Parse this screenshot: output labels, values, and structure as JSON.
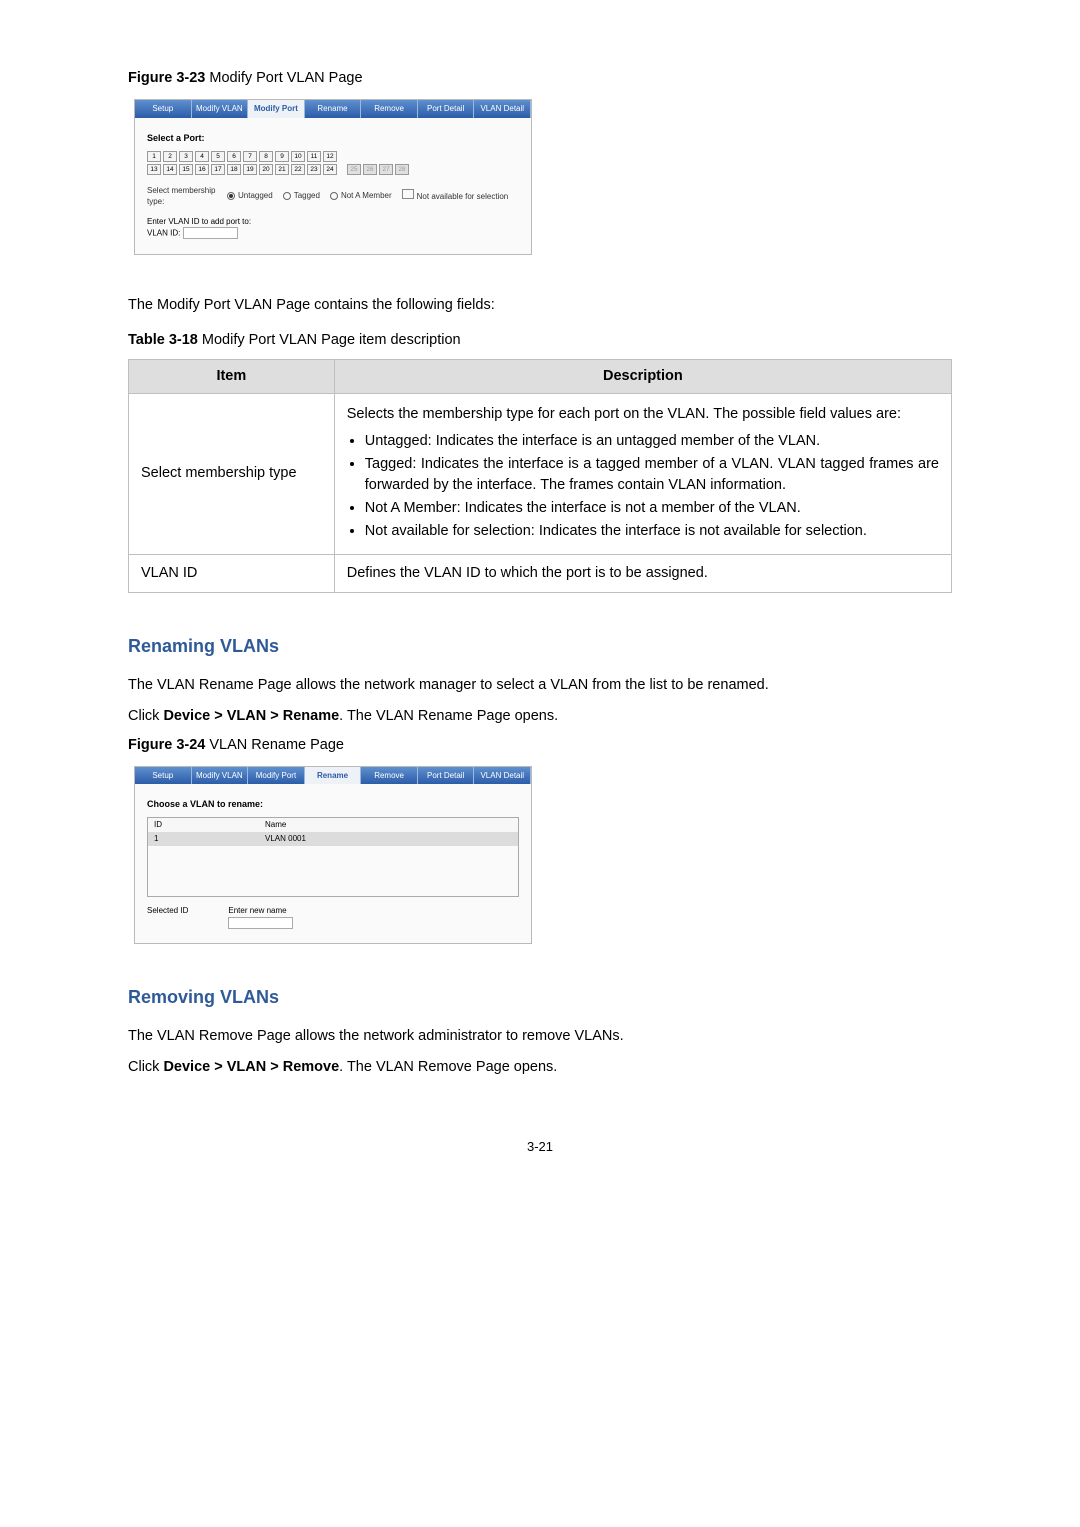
{
  "figure23": {
    "label": "Figure 3-23",
    "title": "Modify Port VLAN Page"
  },
  "screenshot1": {
    "tabs": [
      "Setup",
      "Modify VLAN",
      "Modify Port",
      "Rename",
      "Remove",
      "Port Detail",
      "VLAN Detail"
    ],
    "active_tab_index": 2,
    "select_port_label": "Select a Port:",
    "ports_top": [
      "1",
      "2",
      "3",
      "4",
      "5",
      "6",
      "7",
      "8",
      "9",
      "10",
      "11",
      "12"
    ],
    "ports_bottom_a": [
      "13",
      "14",
      "15",
      "16",
      "17",
      "18",
      "19",
      "20",
      "21",
      "22",
      "23",
      "24"
    ],
    "ports_bottom_b": [
      "25",
      "26",
      "27",
      "28"
    ],
    "mem_label": "Select membership type:",
    "mem_untagged": "Untagged",
    "mem_tagged": "Tagged",
    "mem_not_member": "Not A Member",
    "legend_label": "Not available for selection",
    "enter_vlan_label": "Enter VLAN ID to add port to:",
    "vlan_id_label": "VLAN ID:"
  },
  "intro1": "The Modify Port VLAN Page contains the following fields:",
  "table318": {
    "label": "Table 3-18",
    "title": "Modify Port VLAN Page item description",
    "head_item": "Item",
    "head_desc": "Description",
    "row1_item": "Select membership type",
    "row1_intro": "Selects the membership type for each port on the VLAN. The possible field values are:",
    "row1_b1": "Untagged: Indicates the interface is an untagged member of the VLAN.",
    "row1_b2": "Tagged: Indicates the interface is a tagged member of a VLAN. VLAN tagged frames are forwarded by the interface. The frames contain VLAN information.",
    "row1_b3": "Not A Member: Indicates the interface is not a member of the VLAN.",
    "row1_b4": "Not available for selection: Indicates the interface is not available for selection.",
    "row2_item": "VLAN ID",
    "row2_desc": "Defines the VLAN ID to which the port is to be assigned."
  },
  "renaming": {
    "heading": "Renaming VLANs",
    "para1": "The VLAN Rename Page allows the network manager to select a VLAN from the list to be renamed.",
    "click_prefix": "Click ",
    "breadcrumb": "Device > VLAN > Rename",
    "click_suffix": ". The VLAN Rename Page opens."
  },
  "figure24": {
    "label": "Figure 3-24",
    "title": "VLAN Rename Page"
  },
  "screenshot2": {
    "tabs": [
      "Setup",
      "Modify VLAN",
      "Modify Port",
      "Rename",
      "Remove",
      "Port Detail",
      "VLAN Detail"
    ],
    "active_tab_index": 3,
    "choose_label": "Choose a VLAN to rename:",
    "col_id": "ID",
    "col_name": "Name",
    "row_id": "1",
    "row_name": "VLAN 0001",
    "selected_id_label": "Selected ID",
    "enter_name_label": "Enter new name"
  },
  "removing": {
    "heading": "Removing VLANs",
    "para1": "The VLAN Remove Page allows the network administrator to remove VLANs.",
    "click_prefix": "Click ",
    "breadcrumb": "Device > VLAN > Remove",
    "click_suffix": ". The VLAN Remove Page opens."
  },
  "pager": "3-21"
}
